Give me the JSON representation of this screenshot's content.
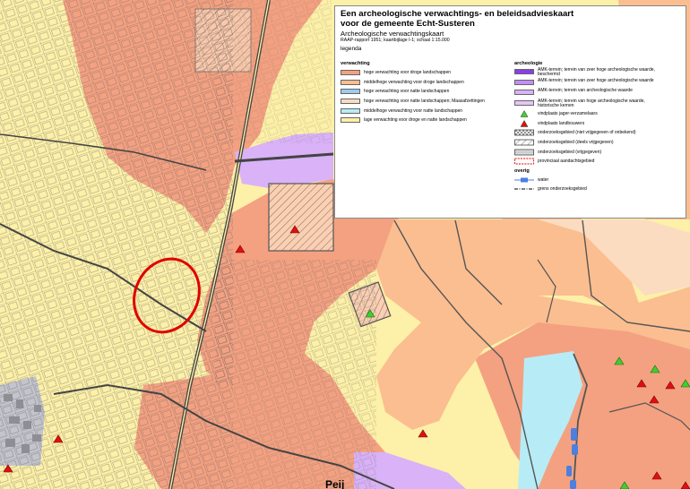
{
  "map": {
    "place_label": "Peij"
  },
  "legend": {
    "title": "Een archeologische verwachtings- en beleidsadvieskaart voor de gemeente Echt-Susteren",
    "subtitle": "Archeologische verwachtingskaart",
    "reference": "RAAP-rapport 1951; kaartbijlage I-1; schaal 1:15.000",
    "heading": "legenda",
    "verwachting": {
      "heading": "verwachting",
      "items": [
        {
          "label": "hoge verwachting voor droge landschappen",
          "color": "#f4a181"
        },
        {
          "label": "middelhoge verwachting voor droge landschappen",
          "color": "#fbbe90"
        },
        {
          "label": "hoge verwachting voor natte landschappen",
          "color": "#9dcbee"
        },
        {
          "label": "hoge verwachting voor natte landschappen; Maasafzettingen",
          "color": "#fbdcc0"
        },
        {
          "label": "middelhoge verwachting voor natte landschappen",
          "color": "#b7ecf6"
        },
        {
          "label": "lage verwachting voor droge en natte landschappen",
          "color": "#fdf0a8"
        }
      ]
    },
    "archeologie": {
      "heading": "archeologie",
      "items": [
        {
          "label": "AMK-terrein; terrein van zeer hoge archeologische waarde, beschermd",
          "color": "#8a3ee8"
        },
        {
          "label": "AMK-terrein; terrein van zeer hoge archeologische waarde",
          "color": "#c58ef5"
        },
        {
          "label": "AMK-terrein; terrein van archeologische waarde",
          "color": "#d9b2f7"
        },
        {
          "label": "AMK-terrein; terrein van hoge archeologische waarde, historische kernen",
          "color": "#e5c6f8"
        }
      ],
      "symbols": [
        {
          "label": "vindplaats jager-verzamelaars",
          "icon": "green-triangle-icon",
          "color": "#3fcf2e"
        },
        {
          "label": "vindplaats landbouwers",
          "icon": "red-triangle-icon",
          "color": "#e01010"
        },
        {
          "label": "onderzoeksgebied (niet vrijgegeven of onbekend)",
          "icon": "crosshatch-icon"
        },
        {
          "label": "onderzoeksgebied (deels vrijgegeven)",
          "icon": "hatch-icon"
        },
        {
          "label": "onderzoeksgebied (vrijgegeven)",
          "icon": "grey-box-icon"
        },
        {
          "label": "provinciaal aandachtsgebied",
          "icon": "red-dashed-box-icon"
        }
      ]
    },
    "overig": {
      "heading": "overig",
      "items": [
        {
          "label": "water",
          "icon": "water-icon",
          "color": "#4c7fe0"
        },
        {
          "label": "grens onderzoeksgebied",
          "icon": "dashed-line-icon"
        }
      ]
    }
  }
}
